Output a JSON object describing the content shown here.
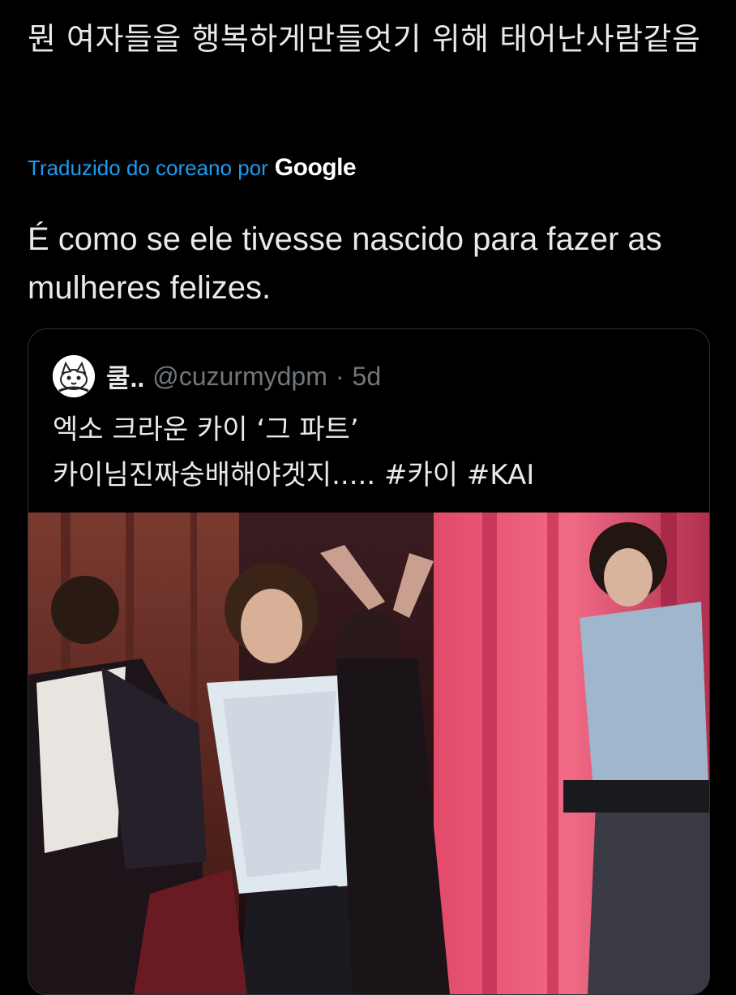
{
  "tweet": {
    "original_text": "뭔 여자들을 행복하게만들엇기 위해 태어난사람같음",
    "translation_label": "Traduzido do coreano por",
    "translation_provider": "Google",
    "translated_text": "É como se ele tivesse nascido para fazer as mulheres felizes."
  },
  "quoted_tweet": {
    "display_name": "쿨..",
    "handle": "@cuzurmydpm",
    "separator": "·",
    "time": "5d",
    "text_line1": "엑소 크라운 카이 ‘그 파트’",
    "text_line2": "카이님진짜숭배해야겟지..... #카이 #KAI"
  },
  "colors": {
    "background": "#000000",
    "text": "#e7e9ea",
    "secondary": "#71767b",
    "link": "#1d9bf0",
    "border": "#2f3336"
  },
  "icons": {
    "avatar": "cat-cartoon-avatar"
  }
}
